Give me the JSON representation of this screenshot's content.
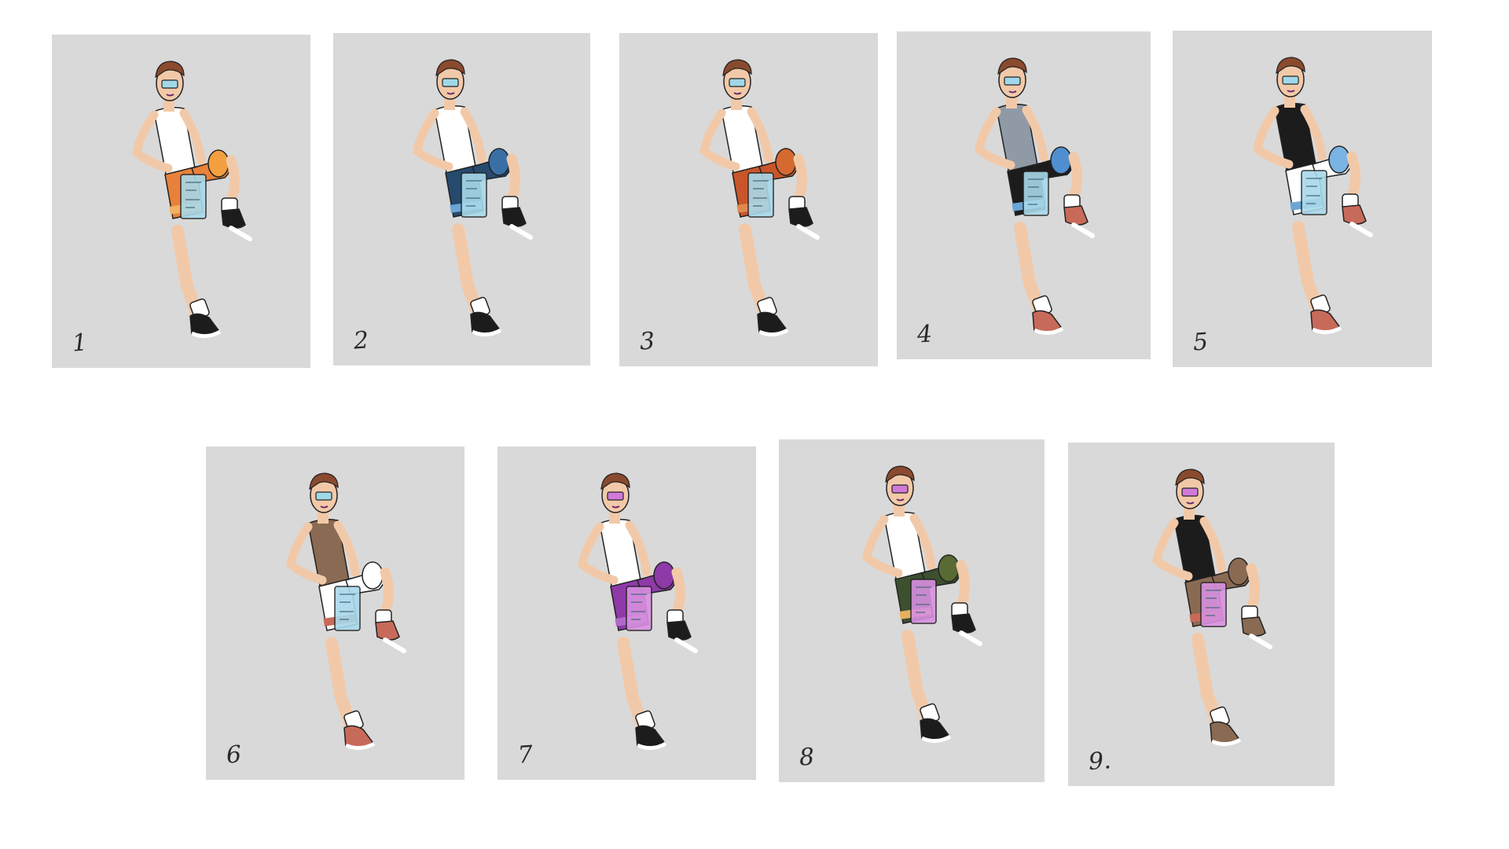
{
  "variants": [
    {
      "label": "1",
      "tank": "#ffffff",
      "shorts": "#e8823a",
      "shorts_band": "#f2b064",
      "knee": "#f2a040",
      "shoes": "#1c1c1c",
      "visor": "#9fd8e8",
      "tablet": "#a8d8ea"
    },
    {
      "label": "2",
      "tank": "#ffffff",
      "shorts": "#254a6e",
      "shorts_band": "#6aa6d6",
      "knee": "#3a6fa6",
      "shoes": "#1c1c1c",
      "visor": "#9fd8e8",
      "tablet": "#a8d8ea"
    },
    {
      "label": "3",
      "tank": "#ffffff",
      "shorts": "#c9562a",
      "shorts_band": "#e0894f",
      "knee": "#d46a30",
      "shoes": "#1c1c1c",
      "visor": "#9fd8e8",
      "tablet": "#a8d8ea"
    },
    {
      "label": "4",
      "tank": "#8f9aa6",
      "shorts": "#1c1c1c",
      "shorts_band": "#6aa6d6",
      "knee": "#4f8fd0",
      "shoes": "#c86a5a",
      "visor": "#9fd8e8",
      "tablet": "#a8d8ea"
    },
    {
      "label": "5",
      "tank": "#1c1c1c",
      "shorts": "#ffffff",
      "shorts_band": "#6aa6d6",
      "knee": "#7ab4e4",
      "shoes": "#c86a5a",
      "visor": "#9fd8e8",
      "tablet": "#a8d8ea"
    },
    {
      "label": "6",
      "tank": "#8a6a52",
      "shorts": "#ffffff",
      "shorts_band": "#c86a5a",
      "knee": "#ffffff",
      "shoes": "#c86a5a",
      "visor": "#9fd8e8",
      "tablet": "#a8d8ea"
    },
    {
      "label": "7",
      "tank": "#ffffff",
      "shorts": "#8e3aa8",
      "shorts_band": "#b068c8",
      "knee": "#8e3aa8",
      "shoes": "#1c1c1c",
      "visor": "#d07ad8",
      "tablet": "#d890e0"
    },
    {
      "label": "8",
      "tank": "#ffffff",
      "shorts": "#3c5030",
      "shorts_band": "#e6b060",
      "knee": "#5a6a34",
      "shoes": "#1c1c1c",
      "visor": "#d07ad8",
      "tablet": "#d890e0"
    },
    {
      "label": "9.",
      "tank": "#1c1c1c",
      "shorts": "#8a6a52",
      "shorts_band": "#c86a5a",
      "knee": "#8a6a52",
      "shoes": "#8a6a52",
      "visor": "#d07ad8",
      "tablet": "#d890e0"
    }
  ]
}
